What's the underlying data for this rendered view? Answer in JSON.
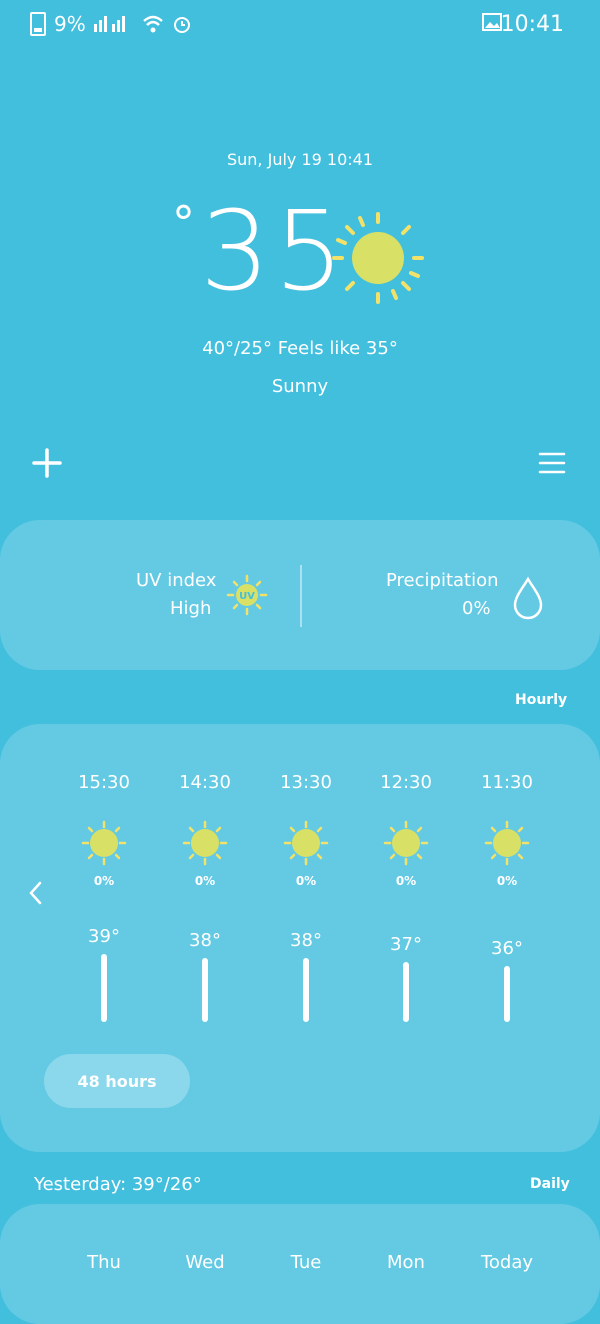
{
  "status_bar": {
    "time": "10:41",
    "battery_text": "9%",
    "icons": [
      "battery-icon",
      "signal-icon",
      "wifi-icon",
      "alarm-icon",
      "gallery-icon"
    ]
  },
  "current": {
    "date": "Sun, July 19 10:41",
    "temperature": "35",
    "degree_symbol": "°",
    "feels": "40°/25° Feels like 35°",
    "condition": "Sunny",
    "icon": "sun-icon"
  },
  "details": {
    "uv_label": "UV index",
    "uv_value": "High",
    "uv_badge": "UV",
    "precip_label": "Precipitation",
    "precip_value": "0%"
  },
  "hourly": {
    "title": "Hourly",
    "button": "48 hours",
    "items": [
      {
        "time": "11:30",
        "precip": "0%",
        "temp": "36°"
      },
      {
        "time": "12:30",
        "precip": "0%",
        "temp": "37°"
      },
      {
        "time": "13:30",
        "precip": "0%",
        "temp": "38°"
      },
      {
        "time": "14:30",
        "precip": "0%",
        "temp": "38°"
      },
      {
        "time": "15:30",
        "precip": "0%",
        "temp": "39°"
      }
    ]
  },
  "daily": {
    "title": "Daily",
    "yesterday": "Yesterday: 39°/26°",
    "days": [
      "Today",
      "Mon",
      "Tue",
      "Wed",
      "Thu"
    ]
  },
  "colors": {
    "background": "#43bfde",
    "sun": "#d9e066",
    "sun_rays": "#f2e26a"
  }
}
